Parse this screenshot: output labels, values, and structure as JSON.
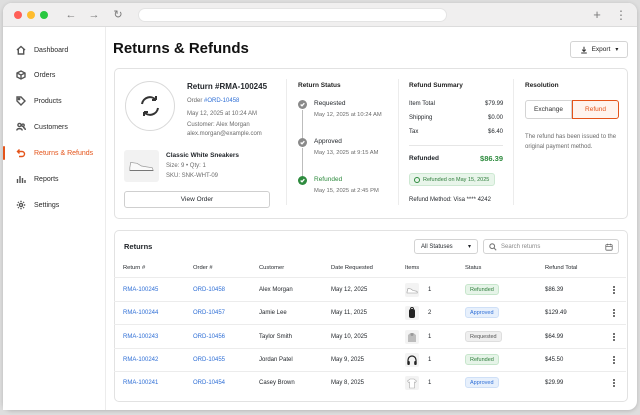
{
  "browser": {},
  "sidebar": {
    "items": [
      {
        "label": "Dashboard",
        "icon": "home-icon"
      },
      {
        "label": "Orders",
        "icon": "box-icon"
      },
      {
        "label": "Products",
        "icon": "tag-icon"
      },
      {
        "label": "Customers",
        "icon": "users-icon"
      },
      {
        "label": "Returns & Refunds",
        "icon": "return-arrow-icon",
        "active": true
      },
      {
        "label": "Reports",
        "icon": "bar-chart-icon"
      },
      {
        "label": "Settings",
        "icon": "gear-icon"
      }
    ]
  },
  "page": {
    "title": "Returns & Refunds",
    "export_label": "Export"
  },
  "detail": {
    "return_id": "Return #RMA-100245",
    "order_prefix": "Order ",
    "order_id": "#ORD-10458",
    "date": "May 12, 2025 at 10:24 AM",
    "customer": "Customer: Alex Morgan",
    "email": "alex.morgan@example.com",
    "product_name": "Classic White Sneakers",
    "product_meta": "Size: 9  •  Qty: 1",
    "sku": "SKU: SNK-WHT-09",
    "view_order_label": "View Order"
  },
  "status": {
    "title": "Return Status",
    "steps": [
      {
        "label": "Requested",
        "date": "May 12, 2025 at 10:24 AM",
        "done": false
      },
      {
        "label": "Approved",
        "date": "May 13, 2025 at 9:15 AM",
        "done": false
      },
      {
        "label": "Refunded",
        "date": "May 15, 2025 at 2:45 PM",
        "done": true
      }
    ]
  },
  "summary": {
    "title": "Refund Summary",
    "rows": [
      {
        "label": "Item Total",
        "value": "$79.99"
      },
      {
        "label": "Shipping",
        "value": "$0.00"
      },
      {
        "label": "Tax",
        "value": "$6.40"
      }
    ],
    "refunded_label": "Refunded",
    "refunded_value": "$86.39",
    "badge": "Refunded on May 15, 2025",
    "method": "Refund Method: Visa **** 4242"
  },
  "resolution": {
    "title": "Resolution",
    "exchange_label": "Exchange",
    "refund_label": "Refund",
    "selected": "Refund",
    "note": "The refund has been issued to the original payment method."
  },
  "returns": {
    "title": "Returns",
    "filter_value": "All Statuses",
    "search_placeholder": "Search returns",
    "columns": [
      "Return #",
      "Order #",
      "Customer",
      "Date Requested",
      "Items",
      "Status",
      "Refund Total"
    ],
    "rows": [
      {
        "rma": "RMA-100245",
        "order": "ORD-10458",
        "customer": "Alex Morgan",
        "date": "May 12, 2025",
        "item_icon": "sneaker-thumbnail",
        "qty": "1",
        "status": "Refunded",
        "total": "$86.39"
      },
      {
        "rma": "RMA-100244",
        "order": "ORD-10457",
        "customer": "Jamie Lee",
        "date": "May 11, 2025",
        "item_icon": "backpack-thumbnail",
        "qty": "2",
        "status": "Approved",
        "total": "$129.49"
      },
      {
        "rma": "RMA-100243",
        "order": "ORD-10456",
        "customer": "Taylor Smith",
        "date": "May 10, 2025",
        "item_icon": "hoodie-thumbnail",
        "qty": "1",
        "status": "Requested",
        "total": "$64.99"
      },
      {
        "rma": "RMA-100242",
        "order": "ORD-10455",
        "customer": "Jordan Patel",
        "date": "May 9, 2025",
        "item_icon": "headphones-thumbnail",
        "qty": "1",
        "status": "Refunded",
        "total": "$45.50"
      },
      {
        "rma": "RMA-100241",
        "order": "ORD-10454",
        "customer": "Casey Brown",
        "date": "May 8, 2025",
        "item_icon": "tshirt-thumbnail",
        "qty": "1",
        "status": "Approved",
        "total": "$29.99"
      }
    ]
  },
  "colors": {
    "accent": "#e4541a",
    "link": "#2f6fd6",
    "success": "#2e8b3e"
  }
}
